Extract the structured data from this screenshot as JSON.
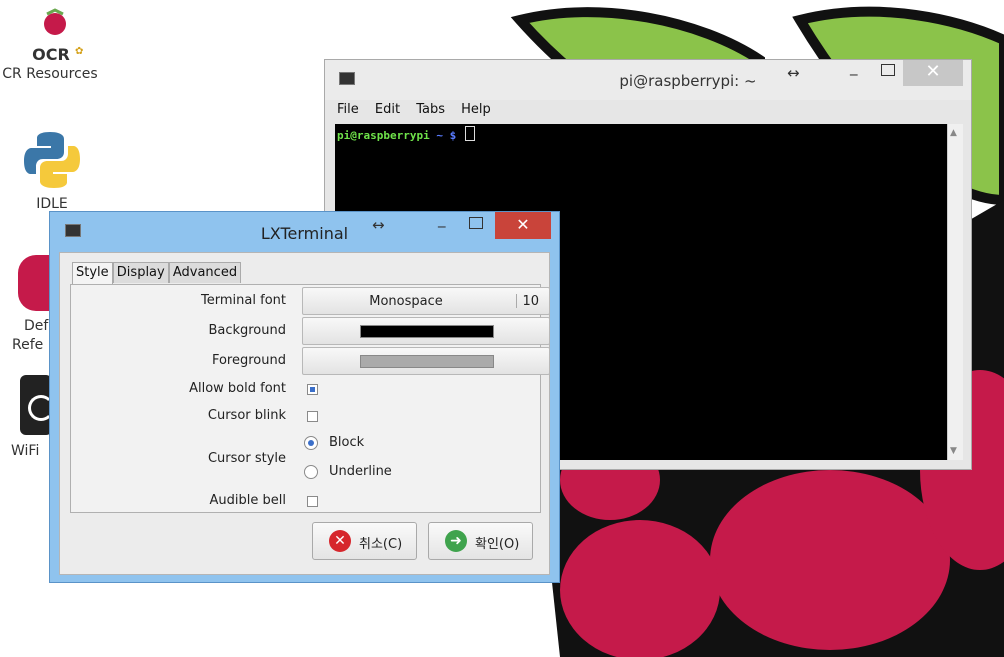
{
  "desktop": {
    "icons": [
      {
        "label": "CR Resources"
      },
      {
        "label": "IDLE"
      },
      {
        "label": "Def"
      },
      {
        "label": "Refe"
      },
      {
        "label": "WiFi"
      }
    ],
    "ocr_logo_text": "OCR"
  },
  "terminal": {
    "title": "pi@raspberrypi: ~",
    "menu": [
      "File",
      "Edit",
      "Tabs",
      "Help"
    ],
    "prompt_user": "pi@raspberrypi",
    "prompt_path": "~ $"
  },
  "prefs": {
    "title": "LXTerminal",
    "tabs": [
      "Style",
      "Display",
      "Advanced"
    ],
    "active_tab": "Style",
    "labels": {
      "terminal_font": "Terminal font",
      "background": "Background",
      "foreground": "Foreground",
      "allow_bold": "Allow bold font",
      "cursor_blink": "Cursor blink",
      "cursor_style": "Cursor style",
      "audible_bell": "Audible bell"
    },
    "font_name": "Monospace",
    "font_size": "10",
    "background_color": "#000000",
    "foreground_color": "#aaaaaa",
    "allow_bold": true,
    "cursor_blink": false,
    "cursor_style_options": [
      "Block",
      "Underline"
    ],
    "cursor_style_selected": "Block",
    "audible_bell": false,
    "cancel_label": "취소(C)",
    "ok_label": "확인(O)"
  }
}
